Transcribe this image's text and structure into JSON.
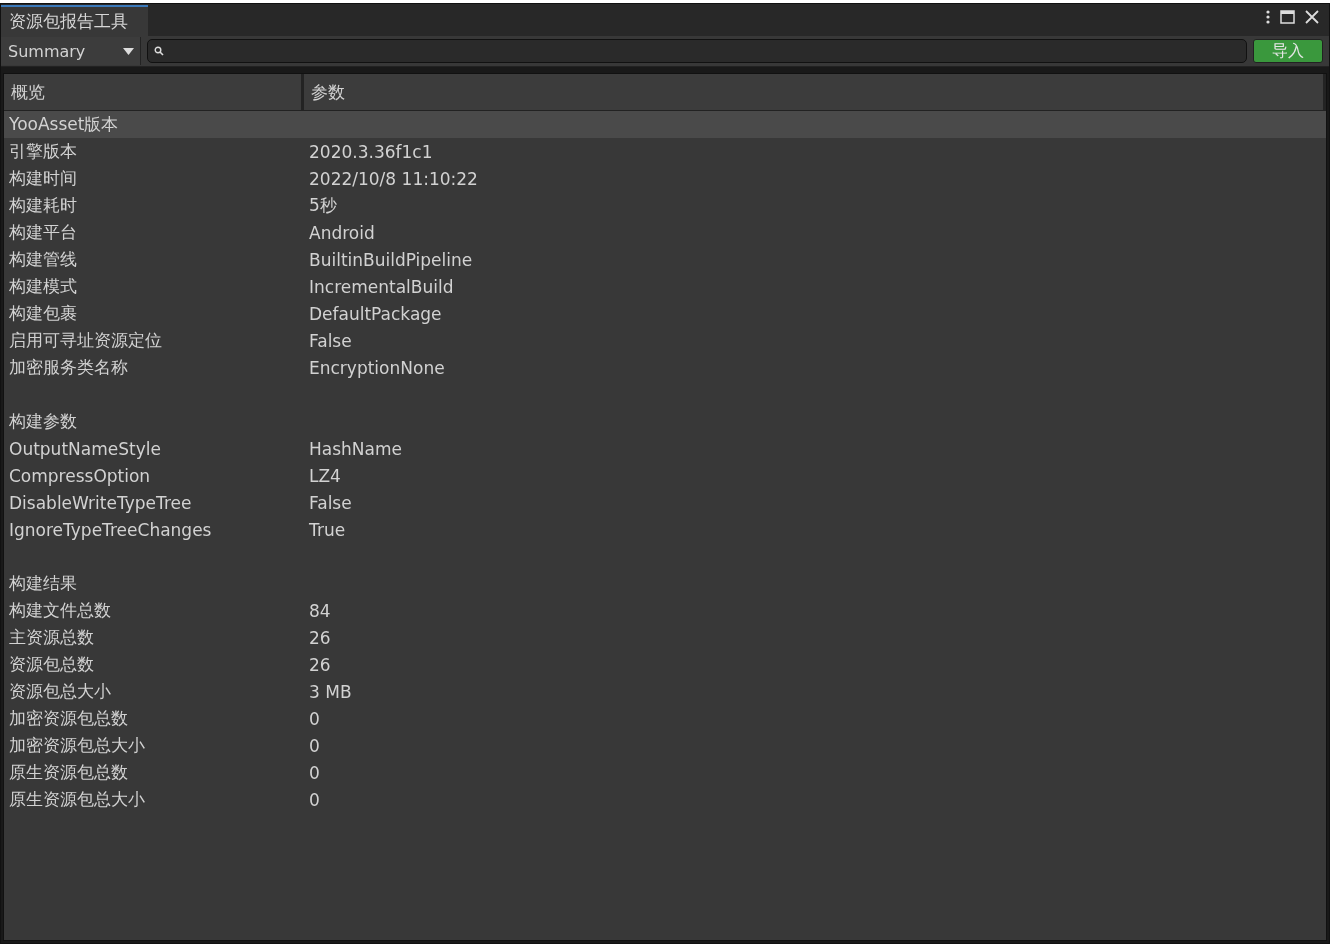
{
  "window": {
    "title": "资源包报告工具"
  },
  "toolbar": {
    "view_dropdown": "Summary",
    "import_button": "导入"
  },
  "table": {
    "columns": [
      "概览",
      "参数"
    ],
    "sections": [
      {
        "rows": [
          {
            "name": "YooAsset版本",
            "selected": true
          },
          {
            "name": "引擎版本",
            "value": "2020.3.36f1c1",
            "selected": false
          },
          {
            "name": "构建时间",
            "value": "2022/10/8 11:10:22",
            "selected": false
          },
          {
            "name": "构建耗时",
            "value": "5秒",
            "selected": false
          },
          {
            "name": "构建平台",
            "value": "Android",
            "selected": false
          },
          {
            "name": "构建管线",
            "value": "BuiltinBuildPipeline",
            "selected": false
          },
          {
            "name": "构建模式",
            "value": "IncrementalBuild",
            "selected": false
          },
          {
            "name": "构建包裹",
            "value": "DefaultPackage",
            "selected": false
          },
          {
            "name": "启用可寻址资源定位",
            "value": "False",
            "selected": false
          },
          {
            "name": "加密服务类名称",
            "value": "EncryptionNone",
            "selected": false
          }
        ]
      },
      {
        "rows": [
          {
            "name": "构建参数",
            "selected": false
          },
          {
            "name": "OutputNameStyle",
            "value": "HashName",
            "selected": false
          },
          {
            "name": "CompressOption",
            "value": "LZ4",
            "selected": false
          },
          {
            "name": "DisableWriteTypeTree",
            "value": "False",
            "selected": false
          },
          {
            "name": "IgnoreTypeTreeChanges",
            "value": "True",
            "selected": false
          }
        ]
      },
      {
        "rows": [
          {
            "name": "构建结果",
            "selected": false
          },
          {
            "name": "构建文件总数",
            "value": "84",
            "selected": false
          },
          {
            "name": "主资源总数",
            "value": "26",
            "selected": false
          },
          {
            "name": "资源包总数",
            "value": "26",
            "selected": false
          },
          {
            "name": "资源包总大小",
            "value": "3 MB",
            "selected": false
          },
          {
            "name": "加密资源包总数",
            "value": "0",
            "selected": false
          },
          {
            "name": "加密资源包总大小",
            "value": "0",
            "selected": false
          },
          {
            "name": "原生资源包总数",
            "value": "0",
            "selected": false
          },
          {
            "name": "原生资源包总大小",
            "value": "0",
            "selected": false
          }
        ]
      }
    ]
  }
}
